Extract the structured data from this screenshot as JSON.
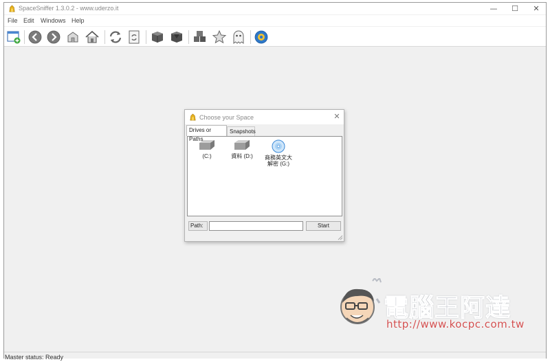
{
  "window": {
    "title": "SpaceSniffer 1.3.0.2 - www.uderzo.it",
    "controls": {
      "minimize": "—",
      "maximize": "☐",
      "close": "✕"
    }
  },
  "menu": {
    "items": [
      "File",
      "Edit",
      "Windows",
      "Help"
    ]
  },
  "toolbar": {
    "buttons": [
      "new-window-icon",
      "back-icon",
      "forward-icon",
      "folder-up-icon",
      "home-icon",
      "refresh-icon",
      "refresh-page-icon",
      "zoom-in-icon",
      "zoom-out-icon",
      "filter-icon",
      "favorite-star-icon",
      "ghost-icon",
      "settings-icon"
    ]
  },
  "dialog": {
    "title": "Choose your Space",
    "close": "✕",
    "tabs": [
      "Drives or Paths",
      "Snapshots"
    ],
    "active_tab": "Drives or Paths",
    "drives": [
      {
        "label": "(C:)",
        "icon": "hard-drive-icon"
      },
      {
        "label": "資料 (D:)",
        "icon": "hard-drive-icon"
      },
      {
        "label_line1": "商務英文大",
        "label_line2": "解密 (G:)",
        "icon": "optical-disc-icon"
      }
    ],
    "path_label": "Path:",
    "path_value": "",
    "start_label": "Start"
  },
  "status": {
    "text": "Master status: Ready"
  },
  "watermark": {
    "name": "電腦王阿達",
    "url": "http://www.kocpc.com.tw"
  },
  "colors": {
    "accent_blue": "#2f78c8",
    "watermark_red": "#d35050",
    "workspace_bg": "#f0f0f0"
  }
}
